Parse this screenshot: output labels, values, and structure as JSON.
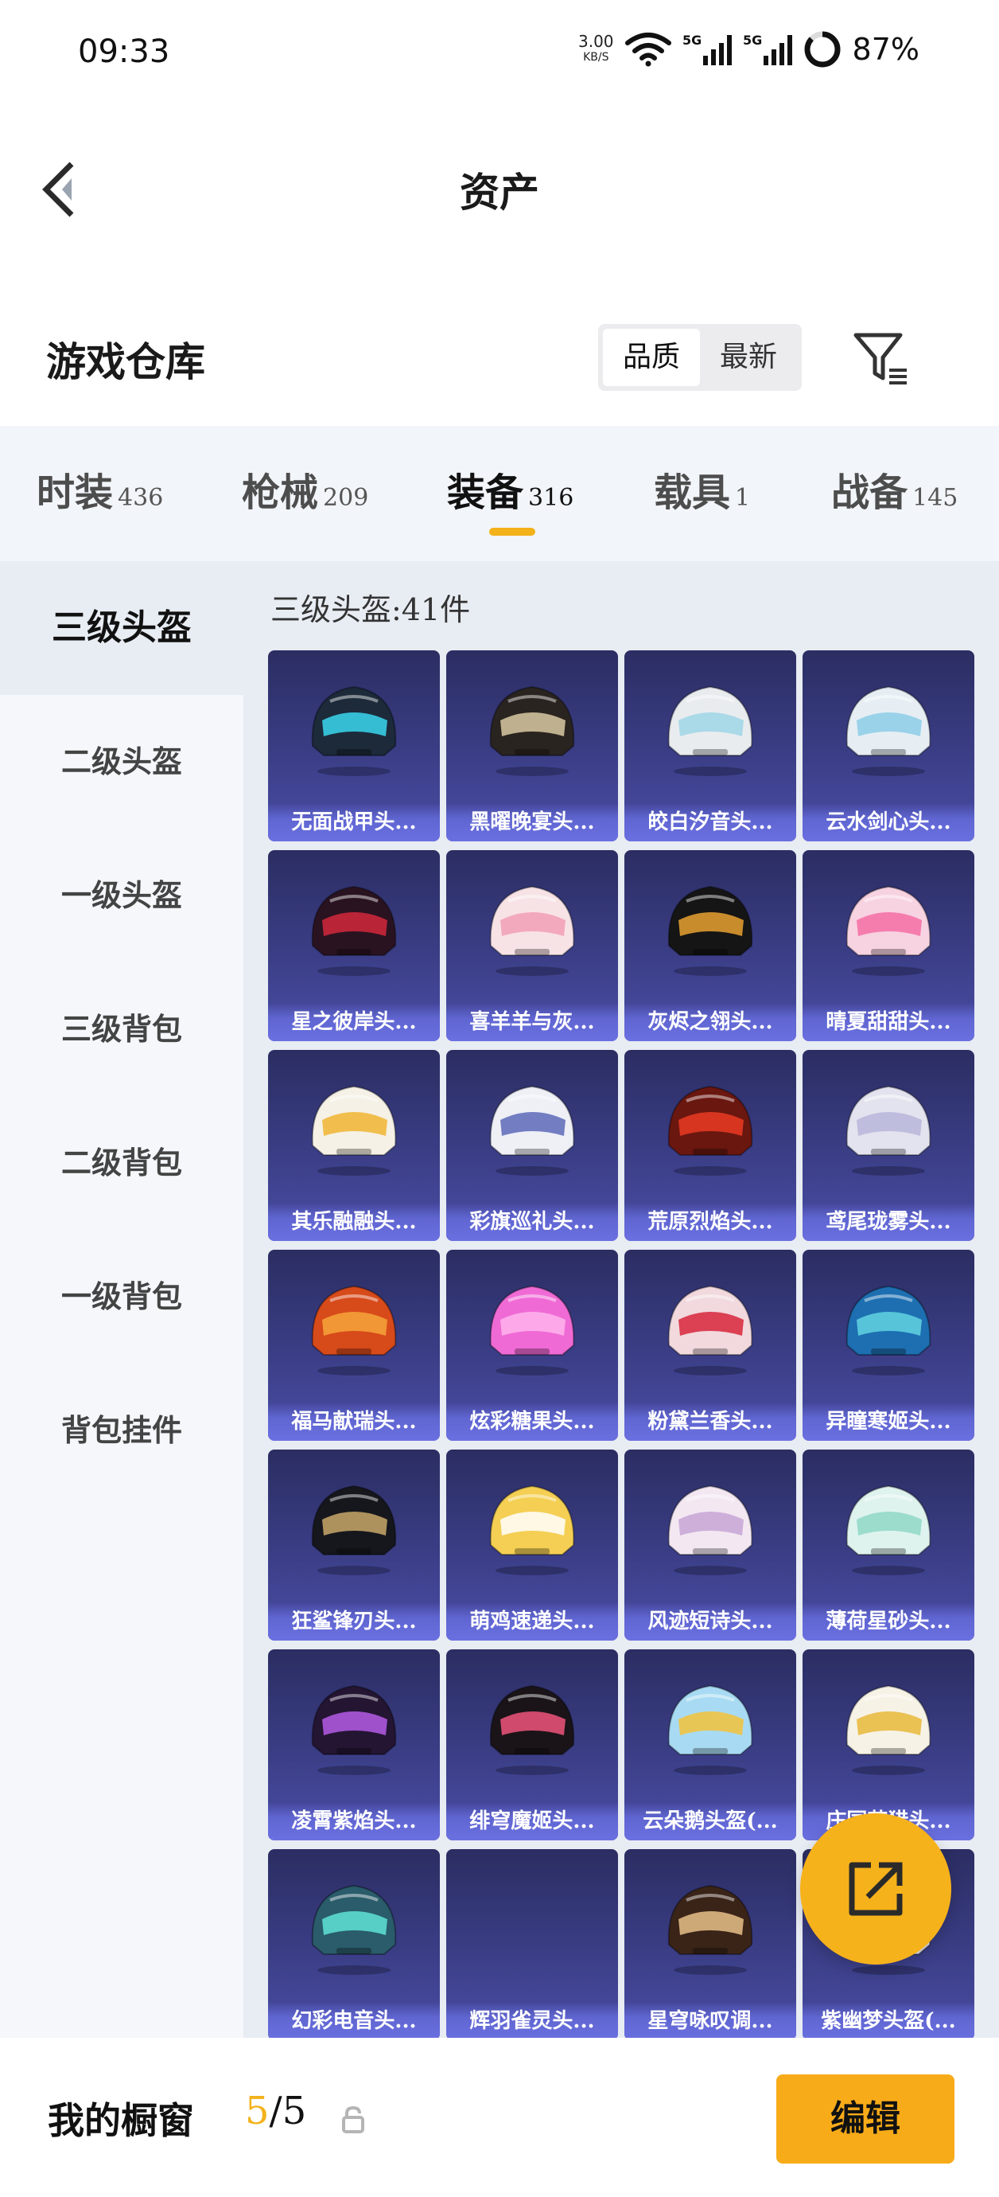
{
  "status_bar": {
    "time": "09:33",
    "speed_value": "3.00",
    "speed_unit": "KB/S",
    "battery": "87%"
  },
  "header": {
    "title": "资产"
  },
  "warehouse": {
    "title": "游戏仓库",
    "sort_options": [
      "品质",
      "最新"
    ],
    "active_sort": "品质"
  },
  "tabs": [
    {
      "label": "时装",
      "count": "436"
    },
    {
      "label": "枪械",
      "count": "209"
    },
    {
      "label": "装备",
      "count": "316"
    },
    {
      "label": "载具",
      "count": "1"
    },
    {
      "label": "战备",
      "count": "145"
    }
  ],
  "active_tab": "装备",
  "sidebar": {
    "items": [
      "三级头盔",
      "二级头盔",
      "一级头盔",
      "三级背包",
      "二级背包",
      "一级背包",
      "背包挂件"
    ],
    "active": "三级头盔"
  },
  "grid": {
    "heading": "三级头盔:41件",
    "items": [
      {
        "label": "无面战甲头...",
        "color": "#1c2a3a",
        "accent": "#3ad7f0"
      },
      {
        "label": "黑曜晚宴头...",
        "color": "#2a2420",
        "accent": "#d9c9a3"
      },
      {
        "label": "皎白汐音头...",
        "color": "#e9ecef",
        "accent": "#9fd6e6"
      },
      {
        "label": "云水剑心头...",
        "color": "#e6eef4",
        "accent": "#8ccde6"
      },
      {
        "label": "星之彼岸头...",
        "color": "#2a1320",
        "accent": "#d2283c"
      },
      {
        "label": "喜羊羊与灰...",
        "color": "#f7e3e6",
        "accent": "#f29fb5"
      },
      {
        "label": "灰烬之翎头...",
        "color": "#151515",
        "accent": "#e8a130"
      },
      {
        "label": "晴夏甜甜头...",
        "color": "#f7d2e0",
        "accent": "#f56fa4"
      },
      {
        "label": "其乐融融头...",
        "color": "#f5f1e6",
        "accent": "#f0b531"
      },
      {
        "label": "彩旗巡礼头...",
        "color": "#eef0f6",
        "accent": "#5d69b8"
      },
      {
        "label": "荒原烈焰头...",
        "color": "#6a1710",
        "accent": "#ea3b22"
      },
      {
        "label": "鸢尾珑雾头...",
        "color": "#e3e3ef",
        "accent": "#b8b6d9"
      },
      {
        "label": "福马献瑞头...",
        "color": "#d74a1a",
        "accent": "#f6a53b"
      },
      {
        "label": "炫彩糖果头...",
        "color": "#f06ad6",
        "accent": "#ffb4ec"
      },
      {
        "label": "粉黛兰香头...",
        "color": "#f1d9dd",
        "accent": "#d7243b"
      },
      {
        "label": "异瞳寒姬头...",
        "color": "#1d6fb1",
        "accent": "#62d4e2"
      },
      {
        "label": "狂鲨锋刃头...",
        "color": "#15171c",
        "accent": "#c9a86a"
      },
      {
        "label": "萌鸡速递头...",
        "color": "#f4cf53",
        "accent": "#ffffff"
      },
      {
        "label": "风迹短诗头...",
        "color": "#f3e8f2",
        "accent": "#c7a4d6"
      },
      {
        "label": "薄荷星砂头...",
        "color": "#dff3ee",
        "accent": "#8fd7c6"
      },
      {
        "label": "凌霄紫焰头...",
        "color": "#241533",
        "accent": "#b55ae6"
      },
      {
        "label": "绯穹魔姬头...",
        "color": "#1a1418",
        "accent": "#f0537b"
      },
      {
        "label": "云朵鹅头盔(...",
        "color": "#a8dbf3",
        "accent": "#f3c23a"
      },
      {
        "label": "庄园花猎头...",
        "color": "#f6f2e6",
        "accent": "#e8b838"
      },
      {
        "label": "幻彩电音头...",
        "color": "#2a5c6b",
        "accent": "#5fe3d6"
      },
      {
        "label": "辉羽雀灵头...",
        "color": "#2e2e66",
        "accent": "#2e2e66"
      },
      {
        "label": "星穹咏叹调...",
        "color": "#3a2418",
        "accent": "#e9c189"
      },
      {
        "label": "紫幽梦头盔(...",
        "color": "#e7e0ee",
        "accent": "#c4a6de"
      }
    ]
  },
  "bottom": {
    "showcase_label": "我的橱窗",
    "showcase_current": "5",
    "showcase_total": "/5",
    "edit_label": "编辑"
  }
}
